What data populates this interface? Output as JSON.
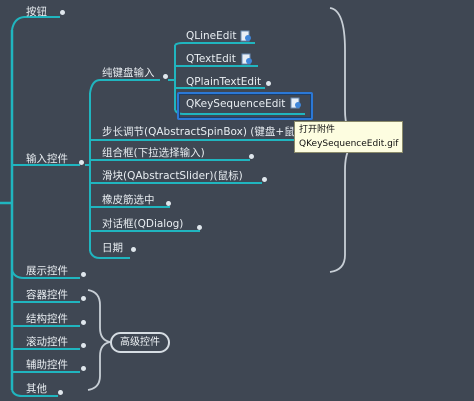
{
  "colors": {
    "background": "#3f4753",
    "branch": "#20b5bf",
    "curve": "#c8cfd6",
    "accent": "#2b78d6"
  },
  "nodes": {
    "buttons": "按钮",
    "input_controls": "输入控件",
    "keyboard_input": "纯键盘输入",
    "qlineedit": "QLineEdit",
    "qtextedit": "QTextEdit",
    "qplaintextedit": "QPlainTextEdit",
    "qkeysequenceedit": "QKeySequenceEdit",
    "spinbox": "步长调节(QAbstractSpinBox) (键盘+鼠",
    "combobox": "组合框(下拉选择输入)",
    "slider": "滑块(QAbstractSlider)(鼠标)",
    "rubberband": "橡皮筋选中",
    "dialog": "对话框(QDialog)",
    "date": "日期",
    "display_controls": "展示控件",
    "container_controls": "容器控件",
    "structure_controls": "结构控件",
    "scroll_controls": "滚动控件",
    "helper_controls": "辅助控件",
    "other": "其他",
    "advanced_controls": "高级控件"
  },
  "tooltip": {
    "title": "打开附件",
    "filename": "QKeySequenceEdit.gif"
  },
  "icons": [
    "attachment-icon"
  ]
}
